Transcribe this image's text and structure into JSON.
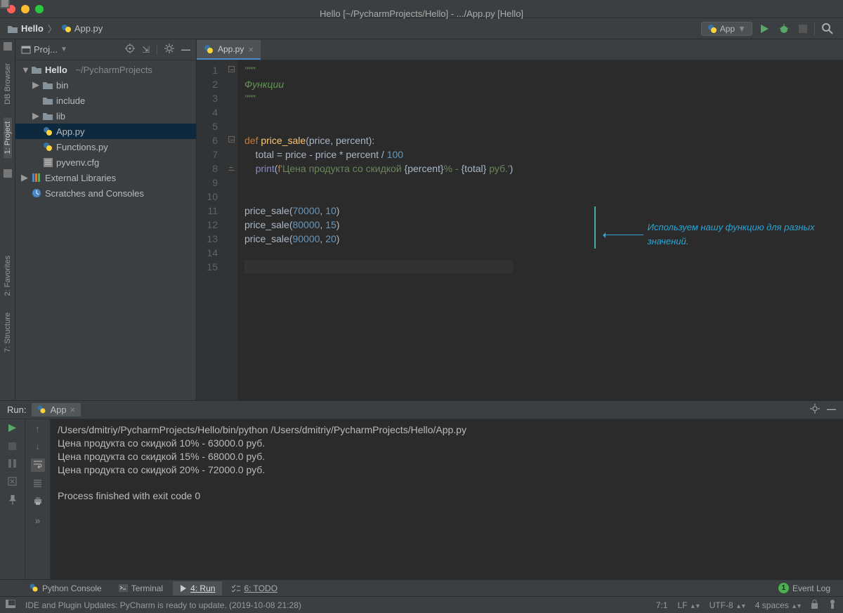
{
  "window": {
    "title": "Hello [~/PycharmProjects/Hello] - .../App.py [Hello]"
  },
  "breadcrumb": {
    "project": "Hello",
    "file": "App.py"
  },
  "run_config": {
    "name": "App"
  },
  "left_tabs": {
    "db": "DB Browser",
    "project": "1: Project",
    "favorites": "2: Favorites",
    "structure": "7: Structure"
  },
  "project_panel": {
    "title": "Proj...",
    "root": "Hello",
    "root_path": "~/PycharmProjects",
    "bin": "bin",
    "include": "include",
    "lib": "lib",
    "app": "App.py",
    "funcs": "Functions.py",
    "cfg": "pyvenv.cfg",
    "ext": "External Libraries",
    "scratch": "Scratches and Consoles"
  },
  "editor": {
    "tab": "App.py",
    "docstr": "Функции",
    "annotation": "Используем нашу функцию для разных значений."
  },
  "run_panel": {
    "title": "Run:",
    "tab": "App",
    "cmd": "/Users/dmitriy/PycharmProjects/Hello/bin/python /Users/dmitriy/PycharmProjects/Hello/App.py",
    "l1": "Цена продукта со скидкой 10% - 63000.0 руб.",
    "l2": "Цена продукта со скидкой 15% - 68000.0 руб.",
    "l3": "Цена продукта со скидкой 20% - 72000.0 руб.",
    "exit": "Process finished with exit code 0"
  },
  "bottom_tools": {
    "console": "Python Console",
    "terminal": "Terminal",
    "run": "4: Run",
    "todo": "6: TODO",
    "eventlog": "Event Log"
  },
  "statusbar": {
    "msg": "IDE and Plugin Updates: PyCharm is ready to update. (2019-10-08 21:28)",
    "pos": "7:1",
    "le": "LF",
    "enc": "UTF-8",
    "indent": "4 spaces"
  }
}
